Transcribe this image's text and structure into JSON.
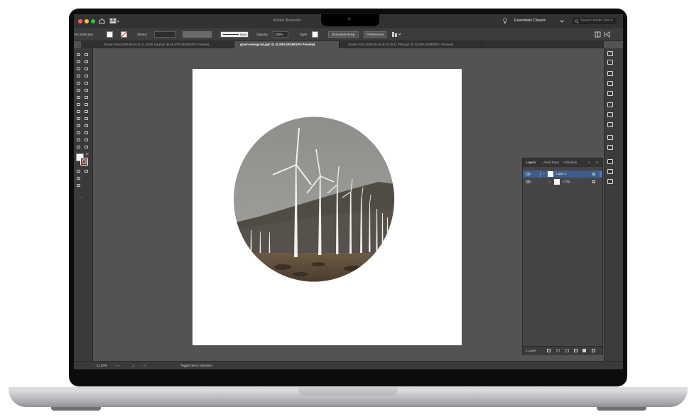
{
  "app": {
    "title": "Adobe Illustrator",
    "workspace": "Essentials Classic",
    "search_placeholder": "Search Adobe Stock"
  },
  "control_bar": {
    "selection_label": "No Selection",
    "stroke_label": "Stroke:",
    "brush_label": "Basic",
    "opacity_label": "Opacity:",
    "opacity_value": "100%",
    "style_label": "Style:",
    "document_setup": "Document Setup",
    "preferences": "Preferences"
  },
  "tabs": [
    {
      "label": "Screen Shot 2019-06-26 at 11.28.06 AM.png* @ 66.67% (RGB/GPU Preview)",
      "active": false
    },
    {
      "label": "green-energy-04.jpg* @ 41.83% (RGB/GPU Preview)",
      "active": true
    },
    {
      "label": "Screen Shot 2019-06-26 at 11.40.11 PM.png* @ 33.33% (RGB/GPU Preview)",
      "active": false
    }
  ],
  "layers_panel": {
    "tabs": [
      "Layers",
      "Asset Expo",
      "Artboards"
    ],
    "rows": [
      {
        "name": "Layer 1"
      },
      {
        "name": "<Clip..."
      }
    ],
    "footer_count": "1 Layer"
  },
  "status_bar": {
    "zoom": "41.83%",
    "artboard_number": "1",
    "tool_hint": "Toggle Direct Selection"
  },
  "colors": {
    "ui_bg": "#535353",
    "panel": "#3c3c3c",
    "selection": "#3f5d8a",
    "layer_color": "#4a7bd6"
  },
  "icons": [
    "home-icon",
    "arrange-icon",
    "lightbulb-icon",
    "search-icon",
    "eye-icon",
    "lock-icon",
    "chevron-down-icon"
  ]
}
